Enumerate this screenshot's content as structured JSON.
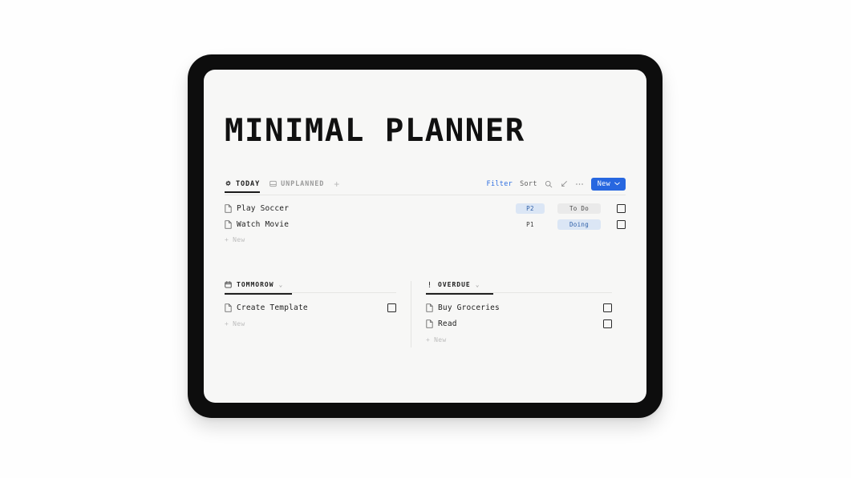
{
  "page": {
    "title": "MINIMAL PLANNER"
  },
  "toolbar": {
    "tabs": [
      {
        "label": "TODAY",
        "icon": "sparkle-icon",
        "active": true
      },
      {
        "label": "UNPLANNED",
        "icon": "window-icon",
        "active": false
      }
    ],
    "add_tab_label": "+",
    "filter_label": "Filter",
    "sort_label": "Sort",
    "search_icon": "search-icon",
    "automation_icon": "arrow-diagonal-icon",
    "more_icon": "ellipsis-icon",
    "new_button_label": "New",
    "new_button_chevron": "⌄",
    "accent_color": "#2767e0"
  },
  "today": {
    "tasks": [
      {
        "name": "Play Soccer",
        "icon": "page-icon",
        "priority": "P2",
        "priority_filled": true,
        "status": "To Do",
        "status_style": "todo",
        "checked": false
      },
      {
        "name": "Watch Movie",
        "icon": "page-icon",
        "priority": "P1",
        "priority_filled": false,
        "status": "Doing",
        "status_style": "doing",
        "checked": false
      }
    ],
    "new_label": "New"
  },
  "sections": [
    {
      "title": "TOMMOROW",
      "icon": "calendar-icon",
      "chevron": "⌄",
      "tasks": [
        {
          "name": "Create Template",
          "icon": "page-icon",
          "checked": false
        }
      ],
      "new_label": "New"
    },
    {
      "title": "OVERDUE",
      "icon": "exclamation-icon",
      "chevron": "⌄",
      "tasks": [
        {
          "name": "Buy Groceries",
          "icon": "page-icon",
          "checked": false
        },
        {
          "name": "Read",
          "icon": "page-icon",
          "checked": false
        }
      ],
      "new_label": "New"
    }
  ]
}
